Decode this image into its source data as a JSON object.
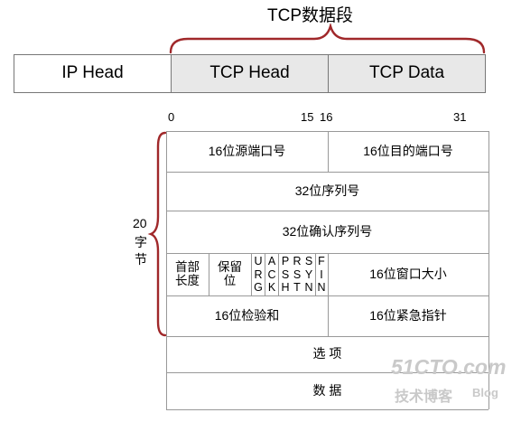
{
  "diagram": {
    "title": "TCP数据段",
    "segment_bar": {
      "ip_head": "IP Head",
      "tcp_head": "TCP Head",
      "tcp_data": "TCP Data",
      "fill_tcp": "#e8e8e8",
      "brace_color": "#a0282a"
    },
    "bits": {
      "b0": "0",
      "b15": "15",
      "b16": "16",
      "b31": "31"
    },
    "side_label": {
      "line1": "20",
      "line2": "字",
      "line3": "节"
    },
    "header": {
      "src_port": "16位源端口号",
      "dst_port": "16位目的端口号",
      "seq": "32位序列号",
      "ack": "32位确认序列号",
      "hdr_len_1": "首部",
      "hdr_len_2": "长度",
      "reserved_1": "保留",
      "reserved_2": "位",
      "flags": [
        {
          "col": "U\nR\nG"
        },
        {
          "col": "A\nC\nK"
        },
        {
          "col": "P\nS\nH"
        },
        {
          "col": "R\nS\nT"
        },
        {
          "col": "S\nY\nN"
        },
        {
          "col": "F\nI\nN"
        }
      ],
      "window": "16位窗口大小",
      "checksum": "16位检验和",
      "urgent": "16位紧急指针",
      "options": "选 项",
      "data": "数 据"
    },
    "watermark": {
      "site": "51CTO.com",
      "sub1": "技术博客",
      "sub2": "Blog"
    }
  }
}
